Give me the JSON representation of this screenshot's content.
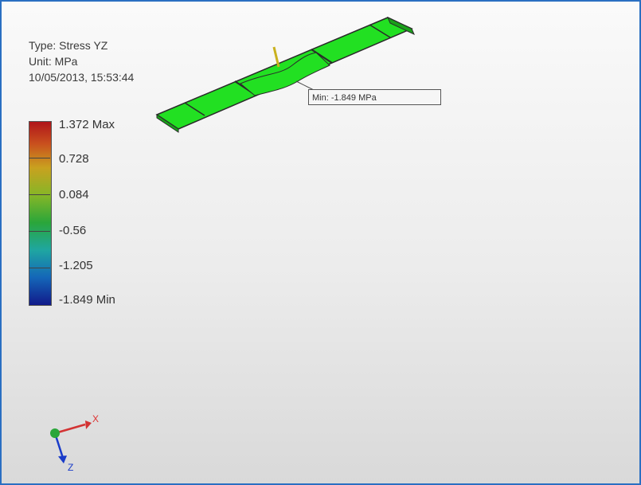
{
  "info": {
    "type": "Type: Stress YZ",
    "unit": "Unit: MPa",
    "timestamp": "10/05/2013, 15:53:44"
  },
  "legend": {
    "labels": [
      "1.372 Max",
      "0.728",
      "0.084",
      "-0.56",
      "-1.205",
      "-1.849 Min"
    ],
    "colors": [
      "#b0151a",
      "#c9a11f",
      "#86b627",
      "#2aa63a",
      "#1fa6a1",
      "#111a8a"
    ]
  },
  "callout": {
    "text": "Min: -1.849 MPa"
  },
  "triad": {
    "x_label": "X",
    "z_label": "Z",
    "x_color": "#d33333",
    "y_color": "#2aa63a",
    "z_color": "#1a3cc9"
  },
  "model": {
    "color": "#22e022",
    "edge_color": "#2a2a2a"
  }
}
